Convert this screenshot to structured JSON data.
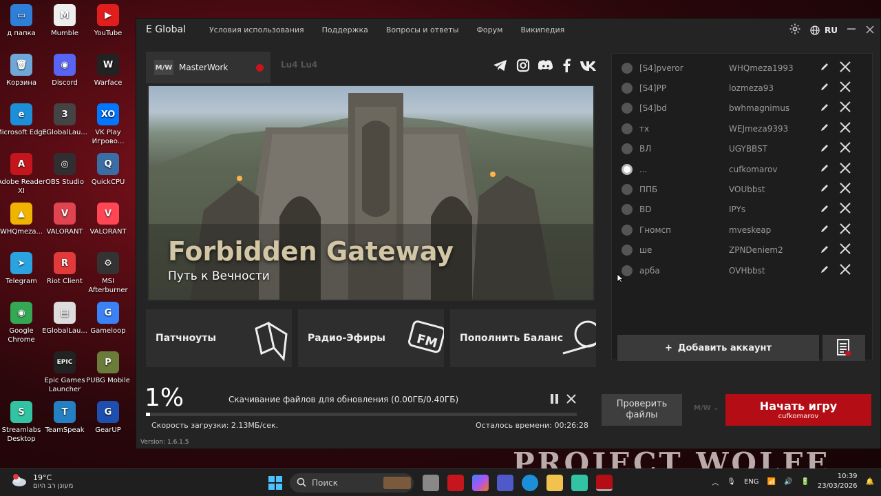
{
  "desktop": {
    "icons": [
      {
        "label": "д папка",
        "color": "#2f7fd6",
        "glyph": "▭"
      },
      {
        "label": "Mumble",
        "color": "#eee",
        "glyph": "M"
      },
      {
        "label": "YouTube",
        "color": "#e01e1e",
        "glyph": "▶"
      },
      {
        "label": "Корзина",
        "color": "#6fa8d8",
        "glyph": "🗑"
      },
      {
        "label": "Discord",
        "color": "#5865f2",
        "glyph": "◉"
      },
      {
        "label": "Warface",
        "color": "#222",
        "glyph": "W"
      },
      {
        "label": "Microsoft Edge",
        "color": "#1d8fd8",
        "glyph": "e"
      },
      {
        "label": "EGlobalLau...",
        "color": "#444",
        "glyph": "3"
      },
      {
        "label": "VK Play Игрово...",
        "color": "#0077ff",
        "glyph": "XO"
      },
      {
        "label": "Adobe Reader XI",
        "color": "#c4161c",
        "glyph": "A"
      },
      {
        "label": "OBS Studio",
        "color": "#302e31",
        "glyph": "◎"
      },
      {
        "label": "QuickCPU",
        "color": "#3a6ea5",
        "glyph": "Q"
      },
      {
        "label": "WHQmeza...",
        "color": "#f0b400",
        "glyph": "▲"
      },
      {
        "label": "VALORANT",
        "color": "#e04450",
        "glyph": "V"
      },
      {
        "label": "VALORANT",
        "color": "#ff4655",
        "glyph": "V"
      },
      {
        "label": "Telegram",
        "color": "#2aa3e0",
        "glyph": "➤"
      },
      {
        "label": "Riot Client",
        "color": "#e03a3a",
        "glyph": "R"
      },
      {
        "label": "MSI Afterburner",
        "color": "#333",
        "glyph": "⚙"
      },
      {
        "label": "Google Chrome",
        "color": "#34a853",
        "glyph": "◉"
      },
      {
        "label": "EGlobalLau...",
        "color": "#ddd",
        "glyph": "▤"
      },
      {
        "label": "Gameloop",
        "color": "#3b82f6",
        "glyph": "G"
      },
      {
        "label": "Epic Games Launcher",
        "color": "#222",
        "glyph": "EPIC"
      },
      {
        "label": "PUBG Mobile",
        "color": "#6b7c3a",
        "glyph": "P"
      },
      {
        "label": "Streamlabs Desktop",
        "color": "#31c3a2",
        "glyph": "S"
      },
      {
        "label": "TeamSpeak",
        "color": "#2580c3",
        "glyph": "T"
      },
      {
        "label": "GearUP",
        "color": "#1e4fae",
        "glyph": "G"
      }
    ],
    "bg_text": "PROJECT WOLFE"
  },
  "app": {
    "brand": "E Global",
    "nav": [
      "Условия использования",
      "Поддержка",
      "Вопросы и ответы",
      "Форум",
      "Википедия"
    ],
    "language": "RU",
    "tab_active": "MasterWork",
    "tab_active_logo": "M/W",
    "tab_inactive": "Lu4   Lu4",
    "banner_title": "Forbidden Gateway",
    "banner_subtitle": "Путь к Вечности",
    "cards": [
      "Патчноуты",
      "Радио-Эфиры",
      "Пополнить Баланс"
    ],
    "accounts": [
      {
        "name": "[S4]pveror",
        "login": "WHQmeza1993",
        "selected": false
      },
      {
        "name": "[S4]PP",
        "login": "lozmeza93",
        "selected": false
      },
      {
        "name": "[S4]bd",
        "login": "bwhmagnimus",
        "selected": false
      },
      {
        "name": "тх",
        "login": "WEJmeza9393",
        "selected": false
      },
      {
        "name": "ВЛ",
        "login": "UGYBBST",
        "selected": false
      },
      {
        "name": "...",
        "login": "cufkomarov",
        "selected": true
      },
      {
        "name": "        ППБ",
        "login": "VOUbbst",
        "selected": false
      },
      {
        "name": "BD",
        "login": "IPYs",
        "selected": false
      },
      {
        "name": "Гномсп",
        "login": "mveskeap",
        "selected": false
      },
      {
        "name": "ше",
        "login": "ZPNDeniem2",
        "selected": false
      },
      {
        "name": "арба",
        "login": "OVHbbst",
        "selected": false
      }
    ],
    "add_account": "Добавить аккаунт",
    "progress_pct_label": "1%",
    "progress_value": 0.01,
    "download_status": "Скачивание файлов для обновления (0.00ГБ/0.40ГБ)",
    "speed": "Скорость загрузки: 2.13МБ/сек.",
    "remaining": "Осталось времени: 00:26:28",
    "version": "Version: 1.6.1.5",
    "check_files": "Проверить файлы",
    "server_select": "M/W",
    "start_game": "Начать игру",
    "start_user": "cufkomarov"
  },
  "taskbar": {
    "temperature": "19°C",
    "weather": "מעונן רב היום",
    "search_placeholder": "Поиск",
    "lang": "ENG",
    "time": "10:39",
    "date": "23/03/2026"
  }
}
